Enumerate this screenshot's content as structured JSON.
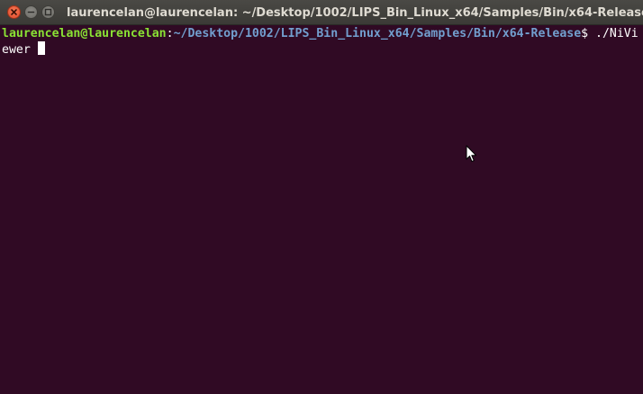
{
  "window": {
    "title": "laurencelan@laurencelan: ~/Desktop/1002/LIPS_Bin_Linux_x64/Samples/Bin/x64-Release"
  },
  "terminal": {
    "user_host": "laurencelan@laurencelan",
    "separator": ":",
    "path": "~/Desktop/1002/LIPS_Bin_Linux_x64/Samples/Bin/x64-Release",
    "prompt_symbol": "$ ",
    "command": "./NiViewer "
  },
  "icons": {
    "close": "close-icon",
    "minimize": "minimize-icon",
    "maximize": "maximize-icon",
    "pointer": "mouse-pointer-icon"
  },
  "colors": {
    "background": "#300a24",
    "user_host": "#8ae234",
    "path": "#729fcf",
    "text": "#ffffff",
    "close_button": "#e0492a"
  }
}
